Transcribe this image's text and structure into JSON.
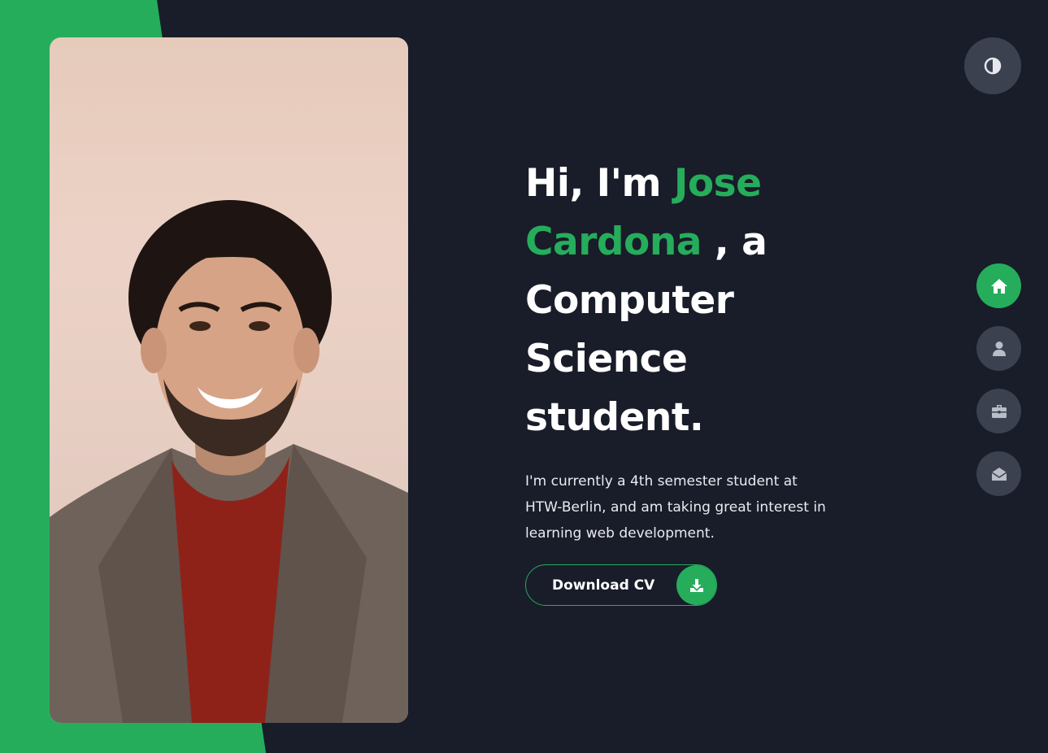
{
  "colors": {
    "background": "#191c29",
    "accent": "#25ad5c",
    "button_gray": "#3c414f",
    "text": "#ffffff"
  },
  "photo": {
    "alt": "Portrait of Jose Cardona"
  },
  "hero": {
    "greeting": "Hi, I'm",
    "name": "Jose Cardona",
    "role_line": ", a Computer Science student.",
    "description": "I'm currently a 4th semester student at HTW-Berlin, and am taking great interest in learning web development."
  },
  "download": {
    "label": "Download CV",
    "icon": "download-icon"
  },
  "theme_toggle": {
    "icon": "contrast-icon"
  },
  "nav": {
    "items": [
      {
        "key": "home",
        "icon": "home-icon",
        "active": true
      },
      {
        "key": "about",
        "icon": "user-icon",
        "active": false
      },
      {
        "key": "portfolio",
        "icon": "briefcase-icon",
        "active": false
      },
      {
        "key": "contact",
        "icon": "envelope-open-icon",
        "active": false
      }
    ]
  }
}
